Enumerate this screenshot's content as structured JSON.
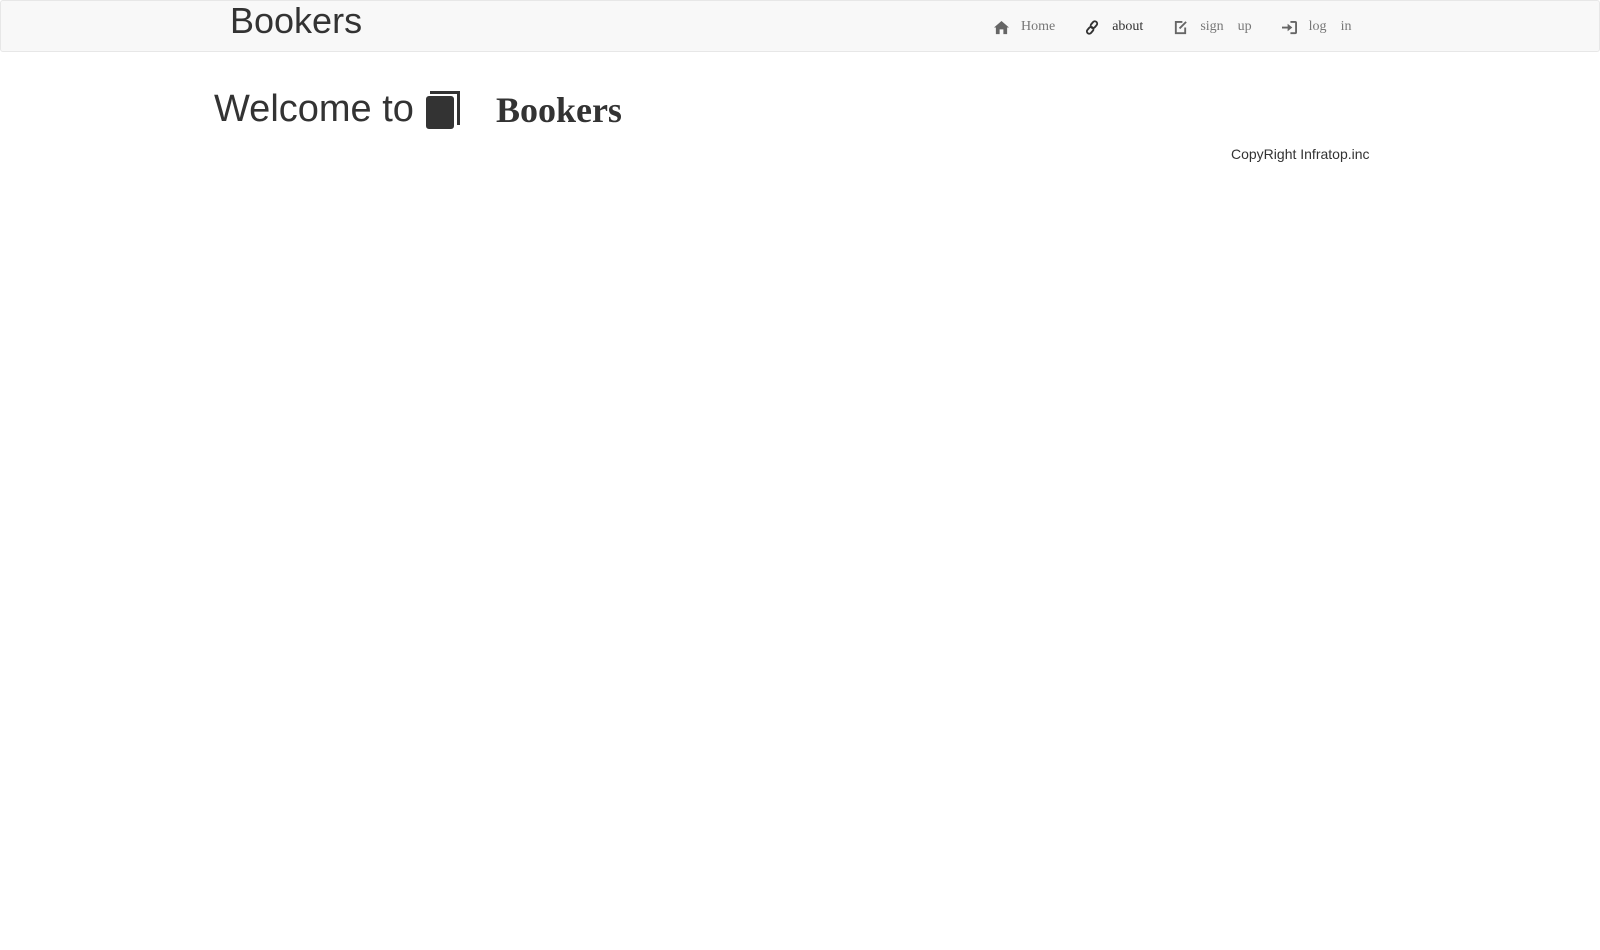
{
  "navbar": {
    "brand": "Bookers",
    "items": [
      {
        "icon": "home-icon",
        "words": [
          "Home"
        ]
      },
      {
        "icon": "link-icon",
        "words": [
          "about"
        ]
      },
      {
        "icon": "edit-icon",
        "words": [
          "sign",
          "up"
        ]
      },
      {
        "icon": "log-in-icon",
        "words": [
          "log",
          "in"
        ]
      }
    ]
  },
  "main": {
    "welcome": "Welcome to",
    "icon": "book-icon",
    "title": "Bookers"
  },
  "footer": {
    "copyright": "CopyRight Infratop.inc"
  }
}
